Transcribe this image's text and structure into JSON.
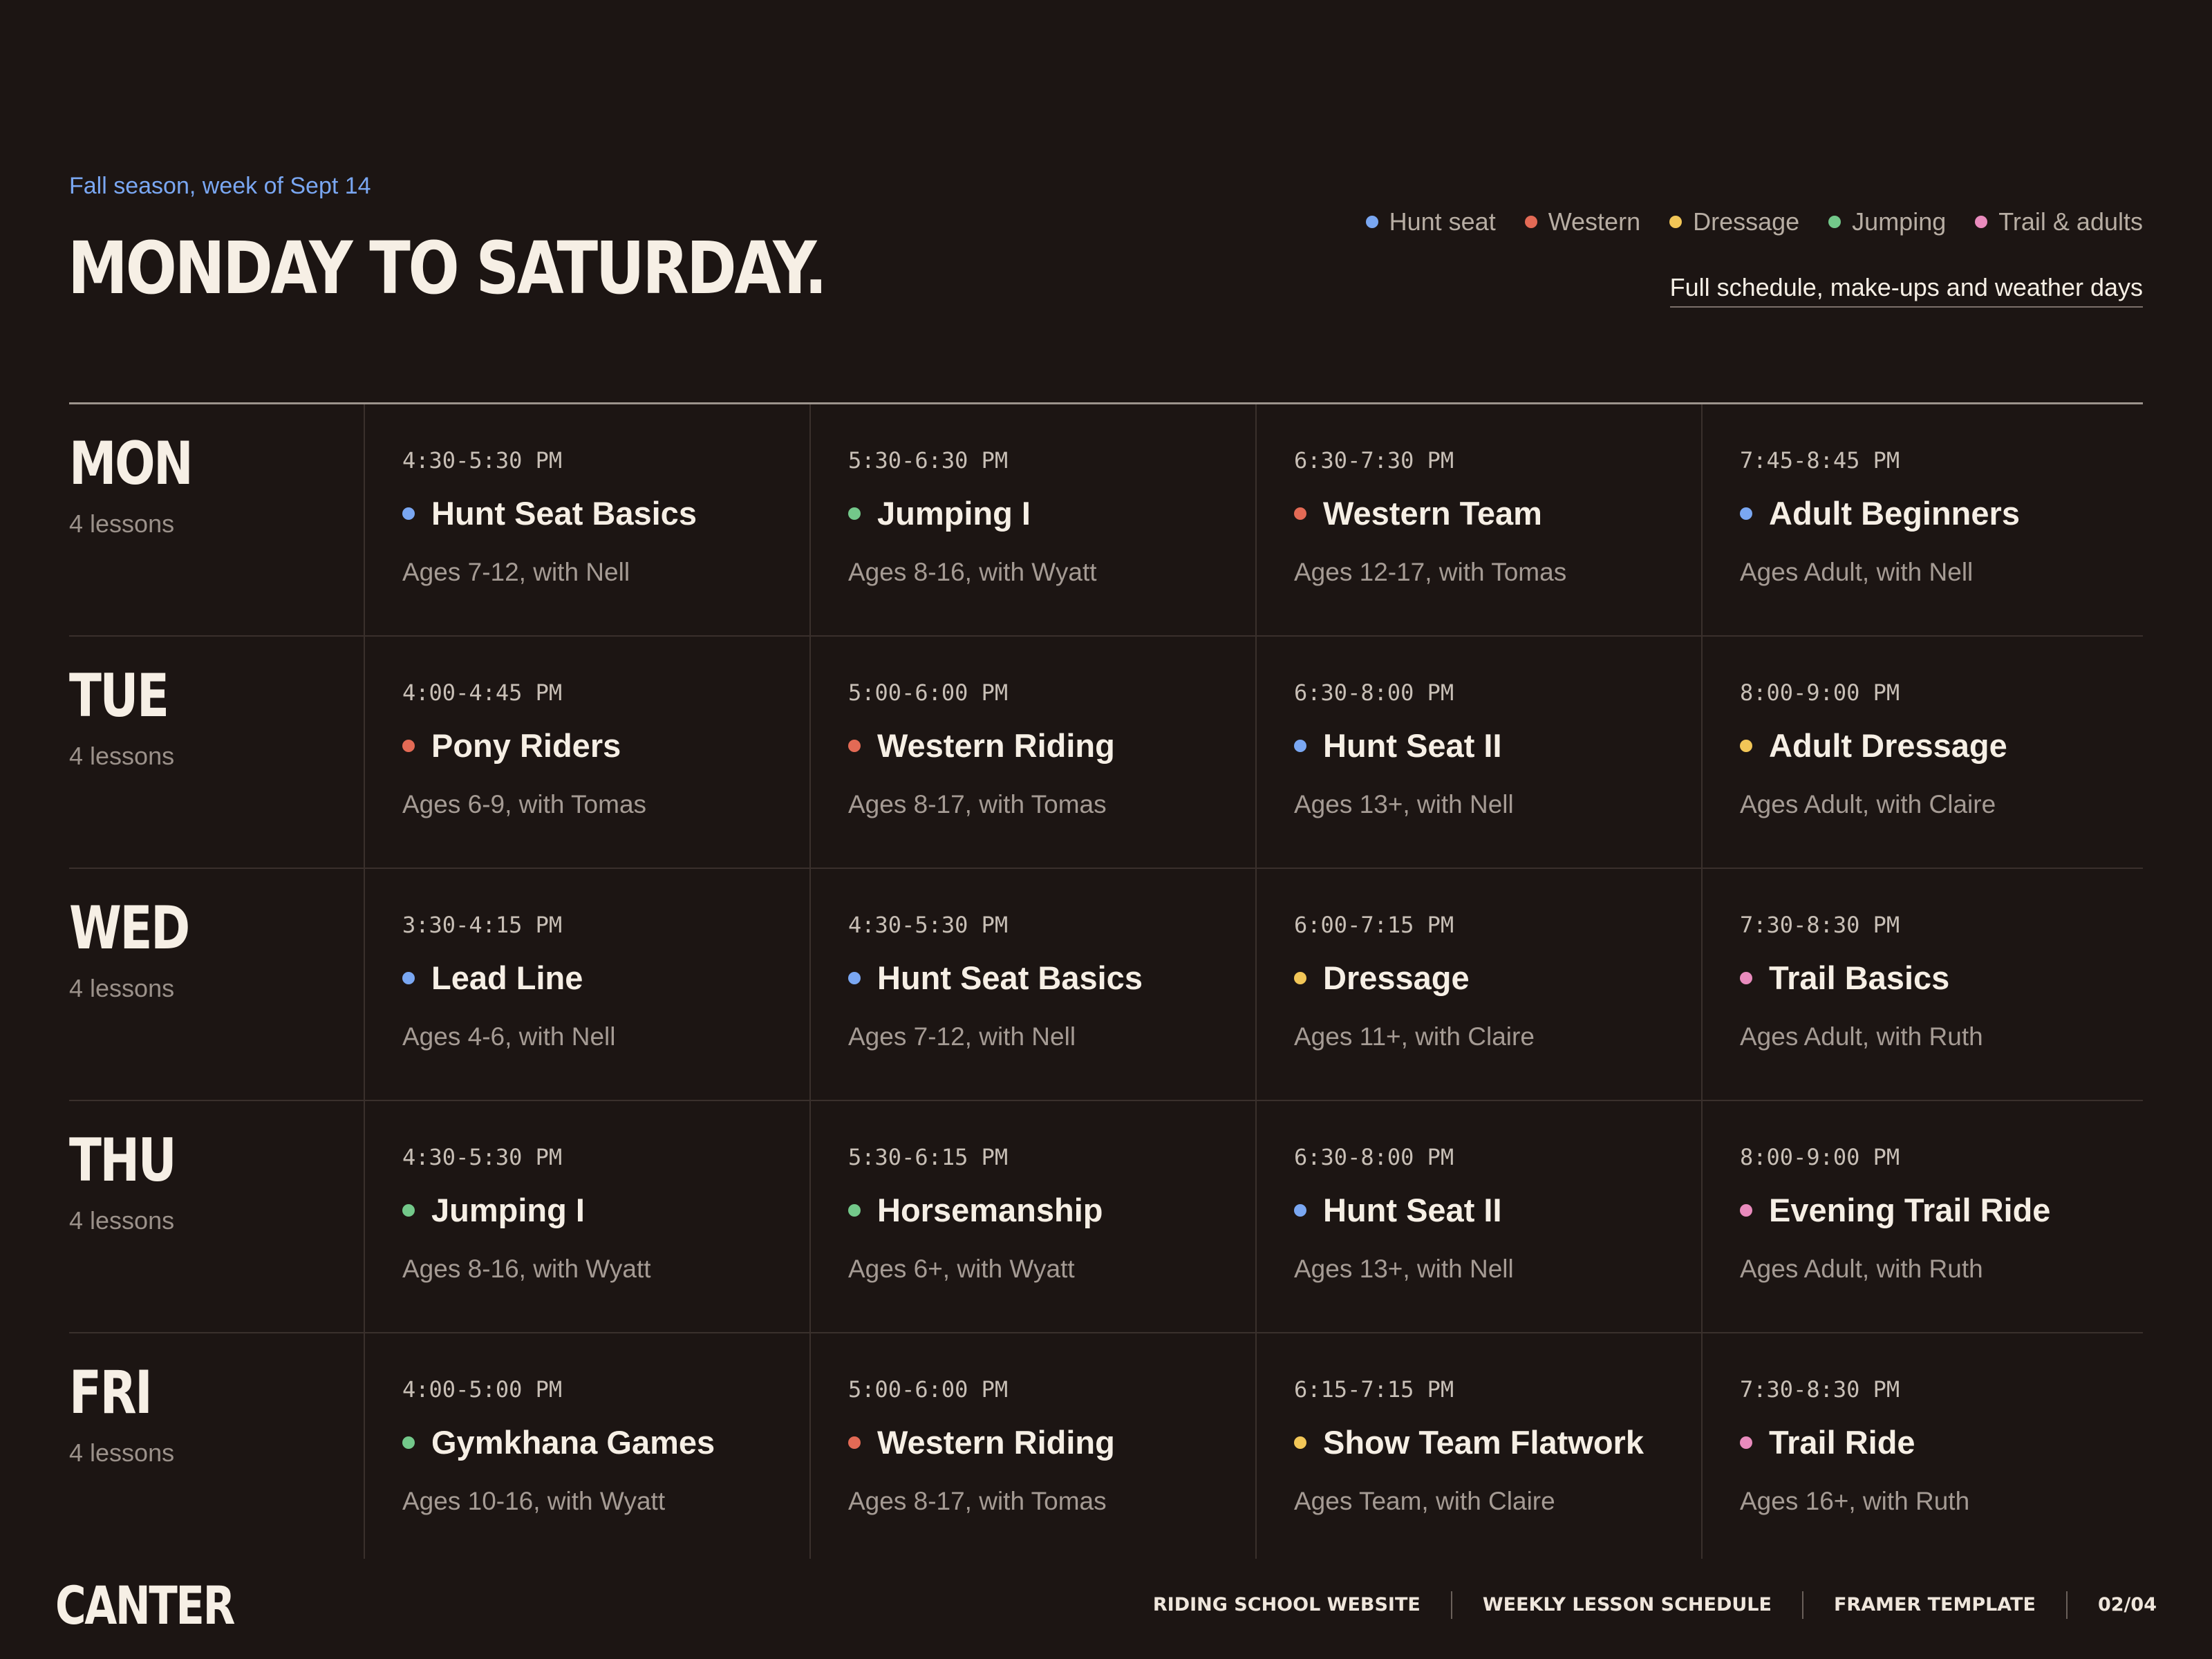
{
  "header": {
    "eyebrow": "Fall season, week of Sept 14",
    "title": "MONDAY TO SATURDAY.",
    "link": "Full schedule, make-ups and weather days"
  },
  "legend": [
    {
      "label": "Hunt seat",
      "color": "#7aa7f2"
    },
    {
      "label": "Western",
      "color": "#e36a55"
    },
    {
      "label": "Dressage",
      "color": "#f2c657"
    },
    {
      "label": "Jumping",
      "color": "#73c88a"
    },
    {
      "label": "Trail & adults",
      "color": "#e98bbd"
    }
  ],
  "days": [
    {
      "name": "MON",
      "count": "4 lessons",
      "lessons": [
        {
          "time": "4:30-5:30 PM",
          "name": "Hunt Seat Basics",
          "meta": "Ages 7-12, with Nell",
          "color": "#7aa7f2"
        },
        {
          "time": "5:30-6:30 PM",
          "name": "Jumping I",
          "meta": "Ages 8-16, with Wyatt",
          "color": "#73c88a"
        },
        {
          "time": "6:30-7:30 PM",
          "name": "Western Team",
          "meta": "Ages 12-17, with Tomas",
          "color": "#e36a55"
        },
        {
          "time": "7:45-8:45 PM",
          "name": "Adult Beginners",
          "meta": "Ages Adult, with Nell",
          "color": "#7aa7f2"
        }
      ]
    },
    {
      "name": "TUE",
      "count": "4 lessons",
      "lessons": [
        {
          "time": "4:00-4:45 PM",
          "name": "Pony Riders",
          "meta": "Ages 6-9, with Tomas",
          "color": "#e36a55"
        },
        {
          "time": "5:00-6:00 PM",
          "name": "Western Riding",
          "meta": "Ages 8-17, with Tomas",
          "color": "#e36a55"
        },
        {
          "time": "6:30-8:00 PM",
          "name": "Hunt Seat II",
          "meta": "Ages 13+, with Nell",
          "color": "#7aa7f2"
        },
        {
          "time": "8:00-9:00 PM",
          "name": "Adult Dressage",
          "meta": "Ages Adult, with Claire",
          "color": "#f2c657"
        }
      ]
    },
    {
      "name": "WED",
      "count": "4 lessons",
      "lessons": [
        {
          "time": "3:30-4:15 PM",
          "name": "Lead Line",
          "meta": "Ages 4-6, with Nell",
          "color": "#7aa7f2"
        },
        {
          "time": "4:30-5:30 PM",
          "name": "Hunt Seat Basics",
          "meta": "Ages 7-12, with Nell",
          "color": "#7aa7f2"
        },
        {
          "time": "6:00-7:15 PM",
          "name": "Dressage",
          "meta": "Ages 11+, with Claire",
          "color": "#f2c657"
        },
        {
          "time": "7:30-8:30 PM",
          "name": "Trail Basics",
          "meta": "Ages Adult, with Ruth",
          "color": "#e98bbd"
        }
      ]
    },
    {
      "name": "THU",
      "count": "4 lessons",
      "lessons": [
        {
          "time": "4:30-5:30 PM",
          "name": "Jumping I",
          "meta": "Ages 8-16, with Wyatt",
          "color": "#73c88a"
        },
        {
          "time": "5:30-6:15 PM",
          "name": "Horsemanship",
          "meta": "Ages 6+, with Wyatt",
          "color": "#73c88a"
        },
        {
          "time": "6:30-8:00 PM",
          "name": "Hunt Seat II",
          "meta": "Ages 13+, with Nell",
          "color": "#7aa7f2"
        },
        {
          "time": "8:00-9:00 PM",
          "name": "Evening Trail Ride",
          "meta": "Ages Adult, with Ruth",
          "color": "#e98bbd"
        }
      ]
    },
    {
      "name": "FRI",
      "count": "4 lessons",
      "lessons": [
        {
          "time": "4:00-5:00 PM",
          "name": "Gymkhana Games",
          "meta": "Ages 10-16, with Wyatt",
          "color": "#73c88a"
        },
        {
          "time": "5:00-6:00 PM",
          "name": "Western Riding",
          "meta": "Ages 8-17, with Tomas",
          "color": "#e36a55"
        },
        {
          "time": "6:15-7:15 PM",
          "name": "Show Team Flatwork",
          "meta": "Ages Team, with Claire",
          "color": "#f2c657"
        },
        {
          "time": "7:30-8:30 PM",
          "name": "Trail Ride",
          "meta": "Ages 16+, with Ruth",
          "color": "#e98bbd"
        }
      ]
    }
  ],
  "footer": {
    "logo": "CANTER",
    "items": [
      "RIDING SCHOOL WEBSITE",
      "WEEKLY LESSON SCHEDULE",
      "FRAMER TEMPLATE",
      "02/04"
    ]
  }
}
